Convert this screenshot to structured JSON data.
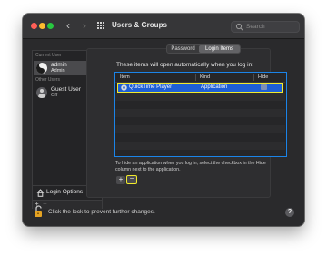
{
  "window": {
    "title": "Users & Groups",
    "search_placeholder": "Search",
    "nav_back": "‹",
    "nav_forward": "›"
  },
  "sidebar": {
    "current_user_heading": "Current User",
    "current_user": {
      "name": "admin",
      "role": "Admin"
    },
    "other_users_heading": "Other Users",
    "other_users": [
      {
        "name": "Guest User",
        "status": "Off"
      }
    ],
    "login_options_label": "Login Options",
    "add_label": "+",
    "remove_label": "−"
  },
  "tabs": {
    "password": "Password",
    "login_items": "Login Items",
    "selected": "Login Items"
  },
  "login_items": {
    "description": "These items will open automatically when you log in:",
    "columns": {
      "item": "Item",
      "kind": "Kind",
      "hide": "Hide"
    },
    "rows": [
      {
        "item": "QuickTime Player",
        "kind": "Application",
        "hide": false,
        "selected": true
      }
    ],
    "hint": "To hide an application when you log in, select the checkbox in the Hide column next to the application.",
    "add_label": "+",
    "remove_label": "−"
  },
  "footer": {
    "lock_text": "Click the lock to prevent further changes.",
    "help_label": "?"
  },
  "colors": {
    "selection": "#1d5fd6",
    "focus_ring": "#1b84e8",
    "highlight": "#f1ea2c"
  },
  "icons": [
    "search-icon",
    "grid-icon",
    "avatar-icon",
    "user-icon",
    "house-icon",
    "app-icon",
    "lock-icon",
    "help-icon"
  ]
}
